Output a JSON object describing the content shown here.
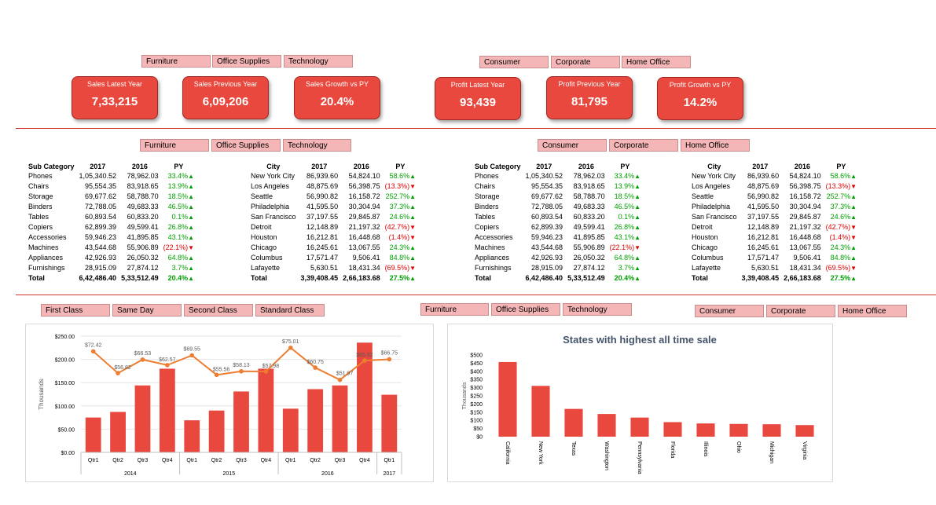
{
  "top_slicers": {
    "category": [
      "Furniture",
      "Office Supplies",
      "Technology"
    ],
    "segment": [
      "Consumer",
      "Corporate",
      "Home Office"
    ]
  },
  "kpis": [
    {
      "label": "Sales Latest Year",
      "value": "7,33,215"
    },
    {
      "label": "Sales Previous Year",
      "value": "6,09,206"
    },
    {
      "label": "Sales Growth vs PY",
      "value": "20.4%"
    },
    {
      "label": "Profit Latest Year",
      "value": "93,439"
    },
    {
      "label": "Profit Previous Year",
      "value": "81,795"
    },
    {
      "label": "Profit Growth vs PY",
      "value": "14.2%"
    }
  ],
  "mid_slicers": {
    "category": [
      "Furniture",
      "Office Supplies",
      "Technology"
    ],
    "segment": [
      "Consumer",
      "Corporate",
      "Home Office"
    ]
  },
  "subcat_table": {
    "headers": [
      "Sub Category",
      "2017",
      "2016",
      "PY"
    ],
    "rows": [
      [
        "Phones",
        "1,05,340.52",
        "78,962.03",
        "33.4%",
        "up"
      ],
      [
        "Chairs",
        "95,554.35",
        "83,918.65",
        "13.9%",
        "up"
      ],
      [
        "Storage",
        "69,677.62",
        "58,788.70",
        "18.5%",
        "up"
      ],
      [
        "Binders",
        "72,788.05",
        "49,683.33",
        "46.5%",
        "up"
      ],
      [
        "Tables",
        "60,893.54",
        "60,833.20",
        "0.1%",
        "up"
      ],
      [
        "Copiers",
        "62,899.39",
        "49,599.41",
        "26.8%",
        "up"
      ],
      [
        "Accessories",
        "59,946.23",
        "41,895.85",
        "43.1%",
        "up"
      ],
      [
        "Machines",
        "43,544.68",
        "55,906.89",
        "(22.1%)",
        "down"
      ],
      [
        "Appliances",
        "42,926.93",
        "26,050.32",
        "64.8%",
        "up"
      ],
      [
        "Furnishings",
        "28,915.09",
        "27,874.12",
        "3.7%",
        "up"
      ]
    ],
    "total": [
      "Total",
      "6,42,486.40",
      "5,33,512.49",
      "20.4%",
      "up"
    ]
  },
  "city_table": {
    "headers": [
      "City",
      "2017",
      "2016",
      "PY"
    ],
    "rows": [
      [
        "New York City",
        "86,939.60",
        "54,824.10",
        "58.6%",
        "up"
      ],
      [
        "Los Angeles",
        "48,875.69",
        "56,398.75",
        "(13.3%)",
        "down"
      ],
      [
        "Seattle",
        "56,990.82",
        "16,158.72",
        "252.7%",
        "up"
      ],
      [
        "Philadelphia",
        "41,595.50",
        "30,304.94",
        "37.3%",
        "up"
      ],
      [
        "San Francisco",
        "37,197.55",
        "29,845.87",
        "24.6%",
        "up"
      ],
      [
        "Detroit",
        "12,148.89",
        "21,197.32",
        "(42.7%)",
        "down"
      ],
      [
        "Houston",
        "16,212.81",
        "16,448.68",
        "(1.4%)",
        "down"
      ],
      [
        "Chicago",
        "16,245.61",
        "13,067.55",
        "24.3%",
        "up"
      ],
      [
        "Columbus",
        "17,571.47",
        "9,506.41",
        "84.8%",
        "up"
      ],
      [
        "Lafayette",
        "5,630.51",
        "18,431.34",
        "(69.5%)",
        "down"
      ]
    ],
    "total": [
      "Total",
      "3,39,408.45",
      "2,66,183.68",
      "27.5%",
      "up"
    ]
  },
  "bottom_slicers": {
    "ship_mode": [
      "First Class",
      "Same Day",
      "Second Class",
      "Standard Class"
    ],
    "category": [
      "Furniture",
      "Office Supplies",
      "Technology"
    ],
    "segment": [
      "Consumer",
      "Corporate",
      "Home Office"
    ]
  },
  "chart_data": [
    {
      "type": "bar",
      "title": "",
      "ylabel": "Thousands",
      "ylim": [
        0,
        250
      ],
      "ytick_labels": [
        "$0.00",
        "$50.00",
        "$100.00",
        "$150.00",
        "$200.00",
        "$250.00"
      ],
      "years": [
        "2014",
        "2015",
        "2016",
        "2017"
      ],
      "categories": [
        "Qtr1",
        "Qtr2",
        "Qtr3",
        "Qtr4",
        "Qtr1",
        "Qtr2",
        "Qtr3",
        "Qtr4",
        "Qtr1",
        "Qtr2",
        "Qtr3",
        "Qtr4",
        "Qtr1"
      ],
      "series": [
        {
          "type": "bar",
          "values": [
            75,
            87,
            144,
            180,
            69,
            90,
            131,
            180,
            94,
            136,
            144,
            236,
            124
          ],
          "color": "#e8483d"
        },
        {
          "type": "line",
          "values": [
            72.42,
            56.82,
            66.53,
            62.57,
            69.55,
            55.56,
            58.13,
            57.98,
            75.01,
            60.75,
            51.97,
            65.82,
            66.75
          ],
          "labels": [
            "$72.42",
            "$56.82",
            "$66.53",
            "$62.57",
            "$69.55",
            "$55.56",
            "$58.13",
            "$57.98",
            "$75.01",
            "$60.75",
            "$51.97",
            "$65.82",
            "$66.75"
          ],
          "color": "#ed7d31"
        }
      ]
    },
    {
      "type": "bar",
      "title": "States with highest all time sale",
      "ylabel": "Thousands",
      "ylim": [
        0,
        500
      ],
      "ytick_labels": [
        "$0",
        "$50",
        "$100",
        "$150",
        "$200",
        "$250",
        "$300",
        "$350",
        "$400",
        "$450",
        "$500"
      ],
      "categories": [
        "California",
        "New York",
        "Texas",
        "Washington",
        "Pennsylvania",
        "Florida",
        "Illinois",
        "Ohio",
        "Michigan",
        "Virginia"
      ],
      "values": [
        457,
        311,
        170,
        139,
        117,
        89,
        81,
        78,
        76,
        71
      ],
      "color": "#e8483d"
    }
  ]
}
